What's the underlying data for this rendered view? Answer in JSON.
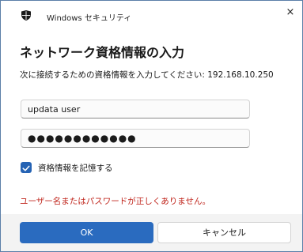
{
  "window": {
    "title": "Windows セキュリティ",
    "close_glyph": "×",
    "app_icon": "windows-security-shield-icon"
  },
  "dialog": {
    "heading": "ネットワーク資格情報の入力",
    "subtext": "次に接続するための資格情報を入力してください: 192.168.10.250",
    "username_value": "updata user",
    "password_value": "●●●●●●●●●●●●",
    "remember_label": "資格情報を記憶する",
    "remember_checked": true,
    "error_message": "ユーザー名またはパスワードが正しくありません。"
  },
  "buttons": {
    "ok_label": "OK",
    "cancel_label": "キャンセル"
  },
  "colors": {
    "accent": "#2a6bbf",
    "error": "#c0261d",
    "footer_bg": "#f3f3f3"
  }
}
